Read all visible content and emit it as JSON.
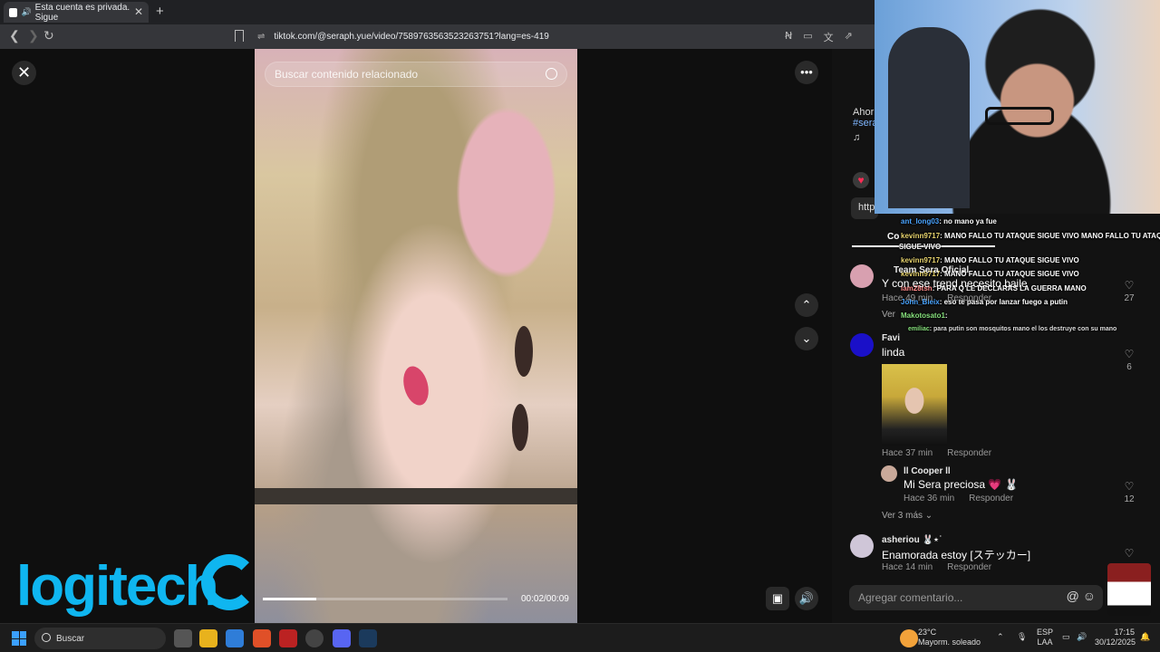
{
  "browser": {
    "tab_title": "Esta cuenta es privada. Sigue",
    "url": "tiktok.com/@seraph.yue/video/7589763563523263751?lang=es-419"
  },
  "player": {
    "search_placeholder": "Buscar contenido relacionado",
    "time": "00:02/00:09",
    "progress": 0.22
  },
  "author": {
    "desc_prefix": "Ahor",
    "hashtag_prefix": "#sera",
    "link_prefix": "http",
    "tab_prefix": "Co"
  },
  "chat": [
    {
      "user": "ant_long03",
      "msg": ": no mano ya fue"
    },
    {
      "user": "kevinn9717",
      "msg": ": MANO FALLO TU ATAQUE SIGUE VIVO MANO FALLO TU ATAQUE"
    },
    {
      "user": "",
      "msg": "SIGUE VIVO"
    },
    {
      "user": "kevinn9717",
      "msg": ": MANO FALLO TU ATAQUE SIGUE VIVO"
    },
    {
      "user": "kevinn9717",
      "msg": ": MANO FALLO TU ATAQUE SIGUE VIVO"
    },
    {
      "user": "lam28tsh",
      "msg": ": PARA Q LE DECLARAS LA GUERRA MANO"
    },
    {
      "user": "John_Bleix",
      "msg": ": eso te pasa por lanzar fuego a putin"
    },
    {
      "user": "Makotosato1",
      "msg": ":"
    },
    {
      "user": "emiliac",
      "msg": ": para putin son mosquitos mano el los destruye con su mano"
    }
  ],
  "comments": [
    {
      "name": "Team Sera Oficial",
      "text": "Y con ese trend necesito baile",
      "meta": "Hace 49 min",
      "reply": "Responder",
      "likes": "27",
      "more": "Ver"
    },
    {
      "name": "Favi",
      "text": "linda",
      "meta": "Hace 37 min",
      "reply": "Responder",
      "likes": "6"
    },
    {
      "name": "ll Cooper ll",
      "text": "Mi Sera preciosa 💗 🐰",
      "meta": "Hace 36 min",
      "reply": "Responder",
      "likes": "12",
      "more": "Ver 3 más ⌄"
    },
    {
      "name": "asheriou 🐰⋆˙",
      "text": "Enamorada estoy [ステッカー]",
      "meta": "Hace 14 min",
      "reply": "Responder",
      "likes": ""
    }
  ],
  "add_comment": {
    "placeholder": "Agregar comentario..."
  },
  "taskbar": {
    "search": "Buscar",
    "temp": "23°C",
    "weather": "Mayorm. soleado",
    "lang1": "ESP",
    "lang2": "LAA",
    "time": "17:15",
    "date": "30/12/2025"
  },
  "overlay": {
    "logo": "logitech"
  }
}
